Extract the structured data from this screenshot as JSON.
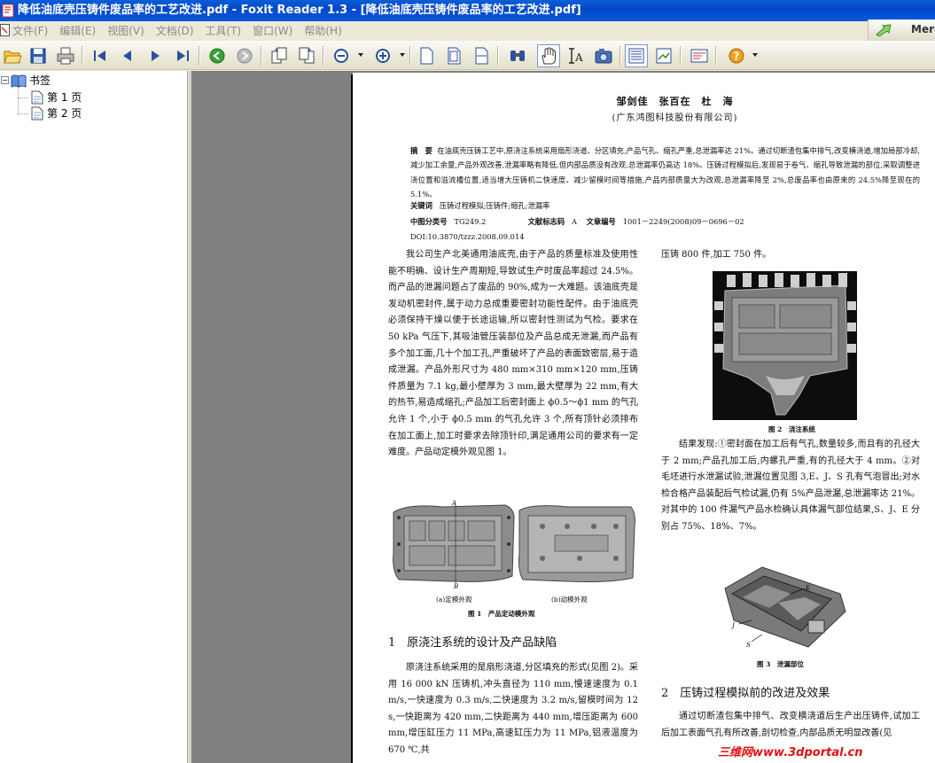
{
  "window": {
    "title": "降低油底壳压铸件废品率的工艺改进.pdf - Foxit Reader 1.3 - [降低油底壳压铸件废品率的工艺改进.pdf]"
  },
  "menu": {
    "items": [
      "文件(F)",
      "编辑(E)",
      "视图(V)",
      "文档(D)",
      "工具(T)",
      "窗口(W)",
      "帮助(H)"
    ],
    "merge_label": "Merge"
  },
  "toolbar": {
    "icons": [
      "open-icon",
      "save-icon",
      "print-icon",
      "first-page-icon",
      "prev-page-icon",
      "next-page-icon",
      "last-page-icon",
      "back-icon",
      "forward-icon",
      "rotate-left-icon",
      "rotate-right-icon",
      "zoom-out-icon",
      "zoom-in-icon",
      "actual-size-icon",
      "fit-page-icon",
      "fit-width-icon",
      "find-icon",
      "hand-tool-icon",
      "text-select-icon",
      "snapshot-icon",
      "continuous-icon",
      "facing-icon",
      "annotate-icon",
      "help-icon"
    ]
  },
  "sidebar": {
    "root_label": "书签",
    "items": [
      {
        "label": "第 1 页"
      },
      {
        "label": "第 2 页"
      }
    ]
  },
  "document": {
    "authors": "邹剑佳　张百在　杜　海",
    "affiliation": "(广东鸿图科技股份有限公司)",
    "abstract_label": "摘　要",
    "abstract_text": "在油底壳压铸工艺中,原浇注系统采用扇形浇道、分区填充,产品气孔、缩孔严重,总泄漏率达 21%。通过切断渣包集中排气,改变横浇道,增加局部冷却,减少加工余量,产品外观改善,泄漏率略有降低,但内部品质没有改观,总泄漏率仍高达 18%。压铸过程模拟后,发现易于卷气、缩孔导致泄漏的部位,采取调整进浇位置和溢流槽位置,适当增大压铸机二快速度、减少留模时间等措施,产品内部质量大为改观,总泄漏率降至 2%,总废品率也由原来的 24.5%降至现在的 5.1%。",
    "keywords_label": "关键词",
    "keywords": "压铸过程模拟;压铸件;缩孔;泄漏率",
    "clc_label": "中图分类号",
    "clc": "TG249.2",
    "doccode_label": "文献标志码",
    "doccode": "A",
    "article_label": "文章编号",
    "article_no": "1001－2249(2008)09－0696－02",
    "doi": "DOI:10.3870/tzzz.2008.09.014",
    "left_para": "我公司生产北美通用油底壳,由于产品的质量标准及使用性能不明确、设计生产周期短,导致试生产时废品率超过 24.5%。而产品的泄漏问题占了废品的 90%,成为一大难题。该油底壳是发动机密封件,属于动力总成重要密封功能性配件。由于油底壳必须保持干燥以便于长途运输,所以密封性测试为气检。要求在 50 kPa 气压下,其吸油管压装部位及产品总成无泄漏,而产品有多个加工面,几十个加工孔,严重破坏了产品的表面致密层,易于造成泄漏。产品外形尺寸为 480 mm×310 mm×120 mm,压铸件质量为 7.1 kg,最小壁厚为 3 mm,最大壁厚为 22 mm,有大的热节,易造成缩孔;产品加工后密封面上 ϕ0.5～ϕ1 mm 的气孔允许 1 个,小于 ϕ0.5 mm 的气孔允许 3 个,所有顶针必须排布在加工面上,加工时要求去除顶针印,满足通用公司的要求有一定难度。产品动定模外观见图 1。",
    "fig1_sub_a": "(a)定模外观",
    "fig1_sub_b": "(b)动模外观",
    "fig1_caption": "图 1　产品定动模外观",
    "fig1_marker_a": "A",
    "fig1_marker_b": "B",
    "section1_heading": "1　原浇注系统的设计及产品缺陷",
    "section1_para": "原浇注系统采用的是扇形浇道,分区填充的形式(见图 2)。采用 16 000 kN 压铸机,冲头直径为 110 mm,慢速速度为 0.1 m/s,一快速度为 0.3 m/s,二快速度为 3.2 m/s,留模时间为 12 s,一快距离为 420 mm,二快距离为 440 mm,增压距离为 600 mm,增压缸压力 11 MPa,高速缸压力为 11 MPa,铝液温度为 670 ℃,共",
    "right_top": "压铸 800 件,加工 750 件。",
    "fig2_caption": "图 2　浇注系统",
    "right_para": "结果发现:①密封面在加工后有气孔,数量较多,而且有的孔径大于 2 mm;产品孔加工后,内螺孔严重,有的孔径大于 4 mm。②对毛坯进行水泄漏试验,泄漏位置见图 3,E、J、S 孔有气泡冒出;对水检合格产品装配后气检试漏,仍有 5%产品泄漏,总泄漏率达 21%。对其中的 100 件漏气产品水检确认具体漏气部位结果,S、J、E 分别占 75%、18%、7%。",
    "fig3_caption": "图 3　泄漏部位",
    "fig3_labels": [
      "E",
      "J",
      "S"
    ],
    "section2_heading": "2　压铸过程模拟前的改进及效果",
    "section2_para": "通过切断渣包集中排气、改变横浇道后生产出压铸件,试加工后加工表面气孔有所改善,剖切检查,内部品质无明显改善(见"
  },
  "watermark": "三维网www.3dportal.cn"
}
